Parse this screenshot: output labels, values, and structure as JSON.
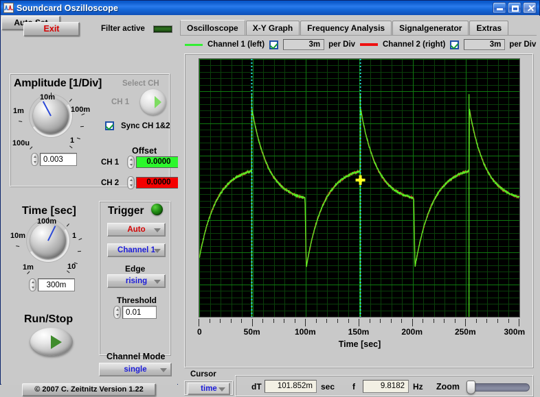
{
  "window": {
    "title": "Soundcard Oszilloscope",
    "icon": "oscilloscope-icon",
    "minimize": "_",
    "maximize": "▫",
    "close": "✕"
  },
  "left": {
    "exit_label": "Exit",
    "filter_label": "Filter active",
    "amplitude": {
      "title": "Amplitude [1/Div]",
      "knob_labels": [
        "1m",
        "10m",
        "100m",
        "1",
        "100u"
      ],
      "value": "0.003"
    },
    "select_ch": {
      "title": "Select CH",
      "channel_label": "CH 1",
      "sync_label": "Sync CH 1&2"
    },
    "offset": {
      "title": "Offset",
      "ch1_label": "CH 1",
      "ch1_value": "0.0000",
      "ch1_color": "#2cf72c",
      "ch2_label": "CH 2",
      "ch2_value": "0.0000",
      "ch2_color": "#f40000"
    },
    "time": {
      "title": "Time [sec]",
      "knob_labels": [
        "10m",
        "100m",
        "1",
        "10",
        "1m"
      ],
      "value": "300m"
    },
    "trigger": {
      "title": "Trigger",
      "mode": "Auto",
      "source": "Channel 1",
      "edge_label": "Edge",
      "edge": "rising",
      "threshold_label": "Threshold",
      "threshold": "0.01",
      "auto_set": "Auto Set"
    },
    "run_stop_label": "Run/Stop",
    "channel_mode_label": "Channel Mode",
    "channel_mode": "single",
    "copyright": "© 2007   C. Zeitnitz Version 1.22"
  },
  "right": {
    "tabs": [
      {
        "label": "Oscilloscope",
        "active": true
      },
      {
        "label": "X-Y Graph",
        "active": false
      },
      {
        "label": "Frequency Analysis",
        "active": false
      },
      {
        "label": "Signalgenerator",
        "active": false
      },
      {
        "label": "Extras",
        "active": false
      }
    ],
    "legend": [
      {
        "name": "Channel 1 (left)",
        "color": "#33ee33",
        "checked": true,
        "div": "3m",
        "per_div": "per Div"
      },
      {
        "name": "Channel 2 (right)",
        "color": "#ee1111",
        "checked": true,
        "div": "3m",
        "per_div": "per Div"
      }
    ],
    "cursor": {
      "label": "Cursor",
      "mode": "time",
      "dt_label": "dT",
      "dt_value": "101.852m",
      "dt_unit": "sec",
      "f_label": "f",
      "f_value": "9.8182",
      "f_unit": "Hz",
      "zoom_label": "Zoom"
    }
  },
  "chart_data": {
    "type": "line",
    "title": "",
    "xlabel": "Time [sec]",
    "ylabel": "",
    "xlim": [
      0,
      0.3
    ],
    "ylim": [
      -0.0132,
      0.0132
    ],
    "xticks": [
      0,
      0.05,
      0.1,
      0.15,
      0.2,
      0.25,
      0.3
    ],
    "xticklabels": [
      "0",
      "50m",
      "100m",
      "150m",
      "200m",
      "250m",
      "300m"
    ],
    "grid": true,
    "grid_color": "#0f7a0f",
    "minor_grid_color": "#0a3f0a",
    "background": "#000000",
    "x_divisions": 6,
    "y_divisions": 8,
    "cursors": [
      {
        "name": "cursor-1",
        "x": 0.0492,
        "color": "#22e0e0",
        "style": "dotted-vertical"
      },
      {
        "name": "cursor-2",
        "x": 0.151,
        "color": "#22e0e0",
        "style": "dotted-vertical"
      }
    ],
    "cursor_marker": {
      "x": 0.151,
      "y": 0.0008,
      "color": "#ffff22"
    },
    "waveform": {
      "shape": "sawtooth-exponential-decay",
      "period_sec": 0.10185,
      "frequency_hz": 9.8182,
      "peaks_x": [
        0.0492,
        0.151,
        0.2528
      ],
      "troughs_x": [
        0.099,
        0.2008
      ],
      "peak_value": 0.0096,
      "trough_value": -0.0081
    },
    "series": [
      {
        "name": "Channel 1 (left)",
        "color": "#55ee22",
        "volts_per_div": 0.003
      },
      {
        "name": "Channel 2 (right)",
        "color": "#cc3322",
        "volts_per_div": 0.003
      }
    ]
  }
}
